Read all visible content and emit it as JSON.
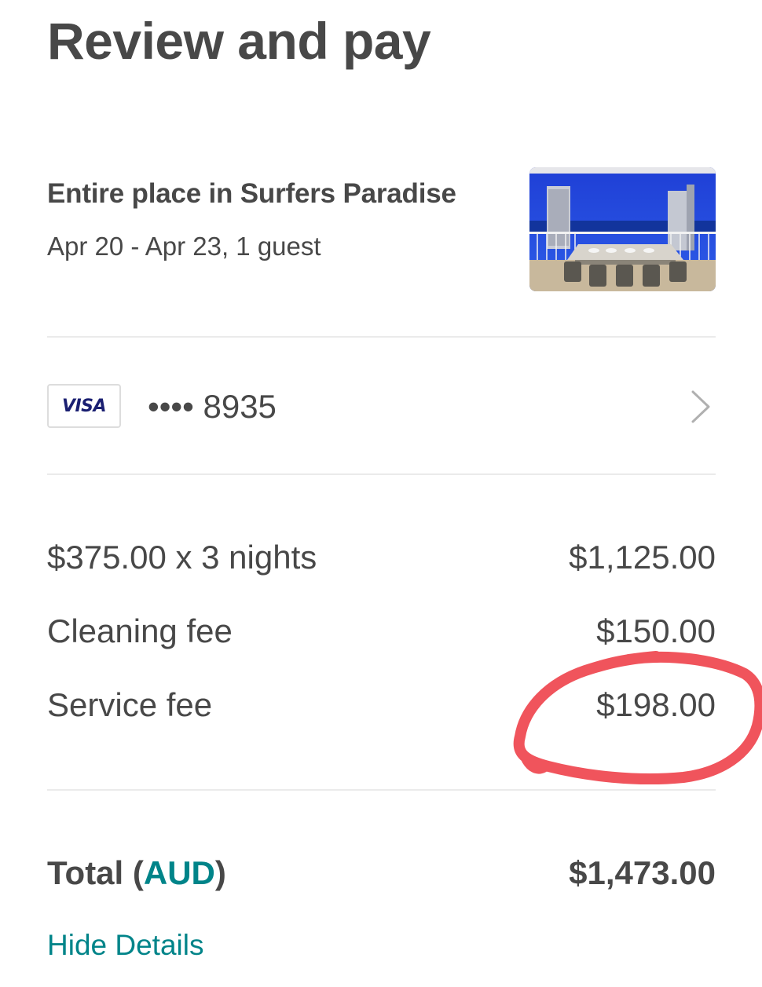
{
  "page": {
    "title": "Review and pay"
  },
  "listing": {
    "title": "Entire place in Surfers Paradise",
    "dates": "Apr 20 - Apr 23, 1 guest",
    "photo_icon": "listing-photo"
  },
  "payment": {
    "card_brand": "VISA",
    "card_number": "•••• 8935",
    "chevron_icon": "chevron-right-icon"
  },
  "price_details": [
    {
      "label": "$375.00 x 3 nights",
      "amount": "$1,125.00"
    },
    {
      "label": "Cleaning fee",
      "amount": "$150.00"
    },
    {
      "label": "Service fee",
      "amount": "$198.00"
    }
  ],
  "total": {
    "label": "Total",
    "currency": "AUD",
    "amount": "$1,473.00"
  },
  "hide_details": "Hide Details",
  "colors": {
    "text": "#484848",
    "accent": "#008489",
    "divider": "#ebebeb",
    "annotation": "#f0545c",
    "visa": "#1a1f71"
  }
}
